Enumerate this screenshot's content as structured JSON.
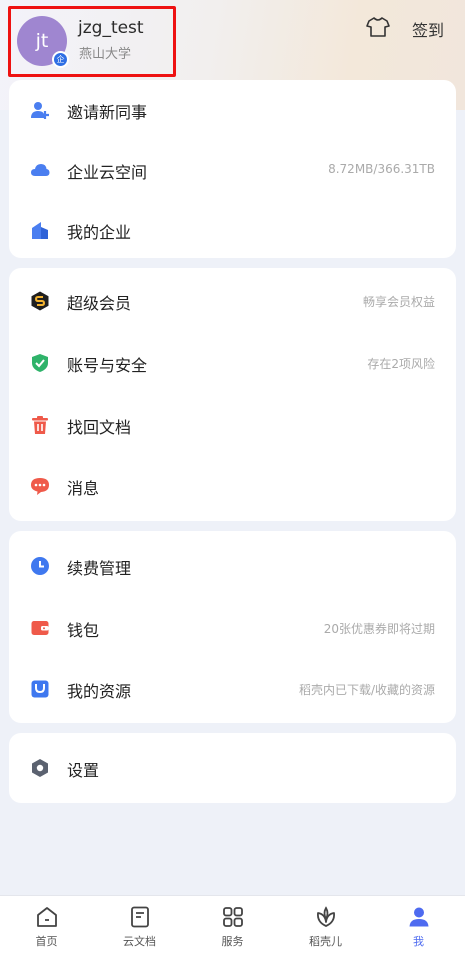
{
  "profile": {
    "avatar_initials": "jt",
    "badge": "企",
    "username": "jzg_test",
    "org": "燕山大学"
  },
  "header": {
    "theme_icon": "tshirt-icon",
    "checkin_label": "签到"
  },
  "card1": [
    {
      "icon": "add-user-icon",
      "label": "邀请新同事",
      "right": ""
    },
    {
      "icon": "cloud-icon",
      "label": "企业云空间",
      "right": "8.72MB/366.31TB"
    },
    {
      "icon": "building-icon",
      "label": "我的企业",
      "right": ""
    }
  ],
  "card2": [
    {
      "icon": "premium-icon",
      "label": "超级会员",
      "right": "畅享会员权益"
    },
    {
      "icon": "shield-icon",
      "label": "账号与安全",
      "right": "存在2项风险"
    },
    {
      "icon": "trash-icon",
      "label": "找回文档",
      "right": ""
    },
    {
      "icon": "message-icon",
      "label": "消息",
      "right": ""
    }
  ],
  "card3": [
    {
      "icon": "clock-icon",
      "label": "续费管理",
      "right": ""
    },
    {
      "icon": "wallet-icon",
      "label": "钱包",
      "right": "20张优惠券即将过期"
    },
    {
      "icon": "resource-icon",
      "label": "我的资源",
      "right": "稻壳内已下载/收藏的资源"
    }
  ],
  "card4": [
    {
      "icon": "settings-icon",
      "label": "设置",
      "right": ""
    }
  ],
  "tabs": [
    {
      "icon": "home-icon",
      "label": "首页",
      "active": false
    },
    {
      "icon": "cloud-doc-icon",
      "label": "云文档",
      "active": false
    },
    {
      "icon": "services-icon",
      "label": "服务",
      "active": false
    },
    {
      "icon": "daoke-icon",
      "label": "稻壳儿",
      "active": false
    },
    {
      "icon": "me-icon",
      "label": "我",
      "active": true
    }
  ],
  "colors": {
    "accent": "#4e6bf0",
    "highlight_border": "#ee1111",
    "avatar_bg": "#9f86d0"
  }
}
